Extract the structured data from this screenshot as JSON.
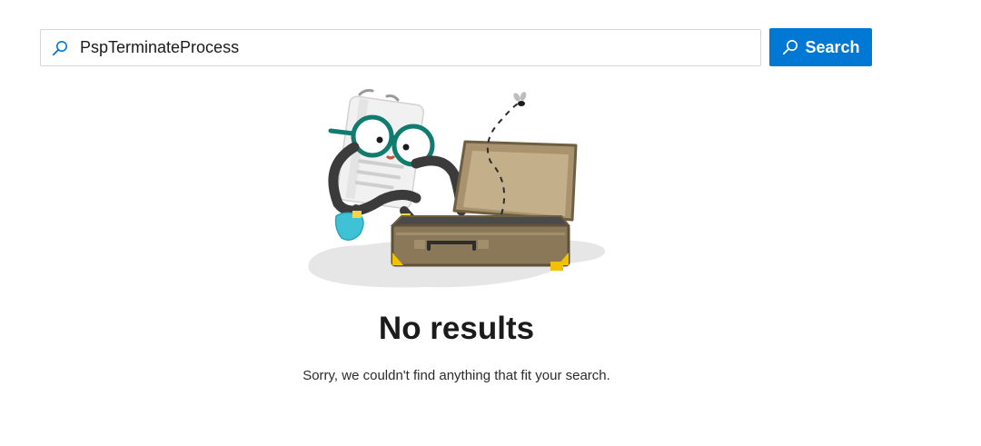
{
  "search": {
    "value": "PspTerminateProcess",
    "icon": "search-icon",
    "button_label": "Search",
    "button_color": "#0078d4"
  },
  "empty_state": {
    "title": "No results",
    "message": "Sorry, we couldn't find anything that fit your search."
  },
  "colors": {
    "accent": "#0078d4",
    "glasses": "#107c6f",
    "suitcase": "#8a7859",
    "shoe": "#3fc1d6"
  }
}
